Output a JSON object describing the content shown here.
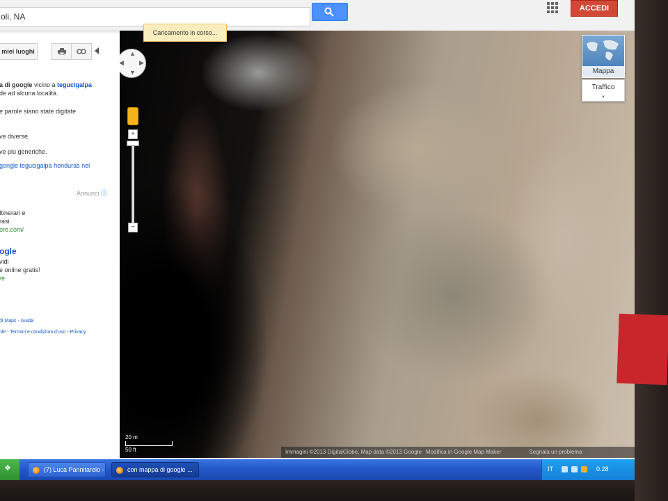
{
  "search": {
    "value": "oli, NA",
    "button_icon": "search-icon"
  },
  "header": {
    "apps_icon": "apps-grid-icon",
    "signin_label": "ACCEDI"
  },
  "loading": {
    "text": "Caricamento in corso..."
  },
  "panel": {
    "my_places": "miei luoghi",
    "print_icon": "print-icon",
    "link_icon": "link-icon",
    "result_prefix": "a di google",
    "result_mid": " vicino a ",
    "result_place": "tegucigalpa",
    "lines": [
      "de ad alcuna località.",
      "e parole siano state digitate",
      "ve diverse.",
      "ve più generiche."
    ],
    "suggestion": "gongle tegucigalpa honduras nel",
    "annunci": "Annunci",
    "ad1_lines": [
      "Itinerari e",
      "rasi"
    ],
    "ad1_url": "ore.com/",
    "ad2_title": "ogle",
    "ad2_lines": [
      "vidi",
      "e online gratis!"
    ],
    "ad2_url": "re",
    "footer1": "di Maps - Guida",
    "footer2": "ole - Termini e condizioni d'uso - Privacy"
  },
  "map": {
    "maptype_label": "Mappa",
    "traffic_label": "Traffico",
    "scale_metric": "20 m",
    "scale_imperial": "50 ft",
    "attribution": "Immagini ©2013 DigitalGlobe, Map data ©2013 Google",
    "attribution_link": "Modifica in Google Map Maker",
    "report": "Segnala un problema"
  },
  "taskbar": {
    "tasks": [
      "(7) Luca Pannitarelo - ...",
      "con mappa di google ..."
    ],
    "lang": "IT",
    "clock": "0.28"
  },
  "colors": {
    "accent_blue": "#4d90fe",
    "signin_red": "#d14836",
    "link_blue": "#1155cc",
    "taskbar_blue": "#2256c8"
  }
}
